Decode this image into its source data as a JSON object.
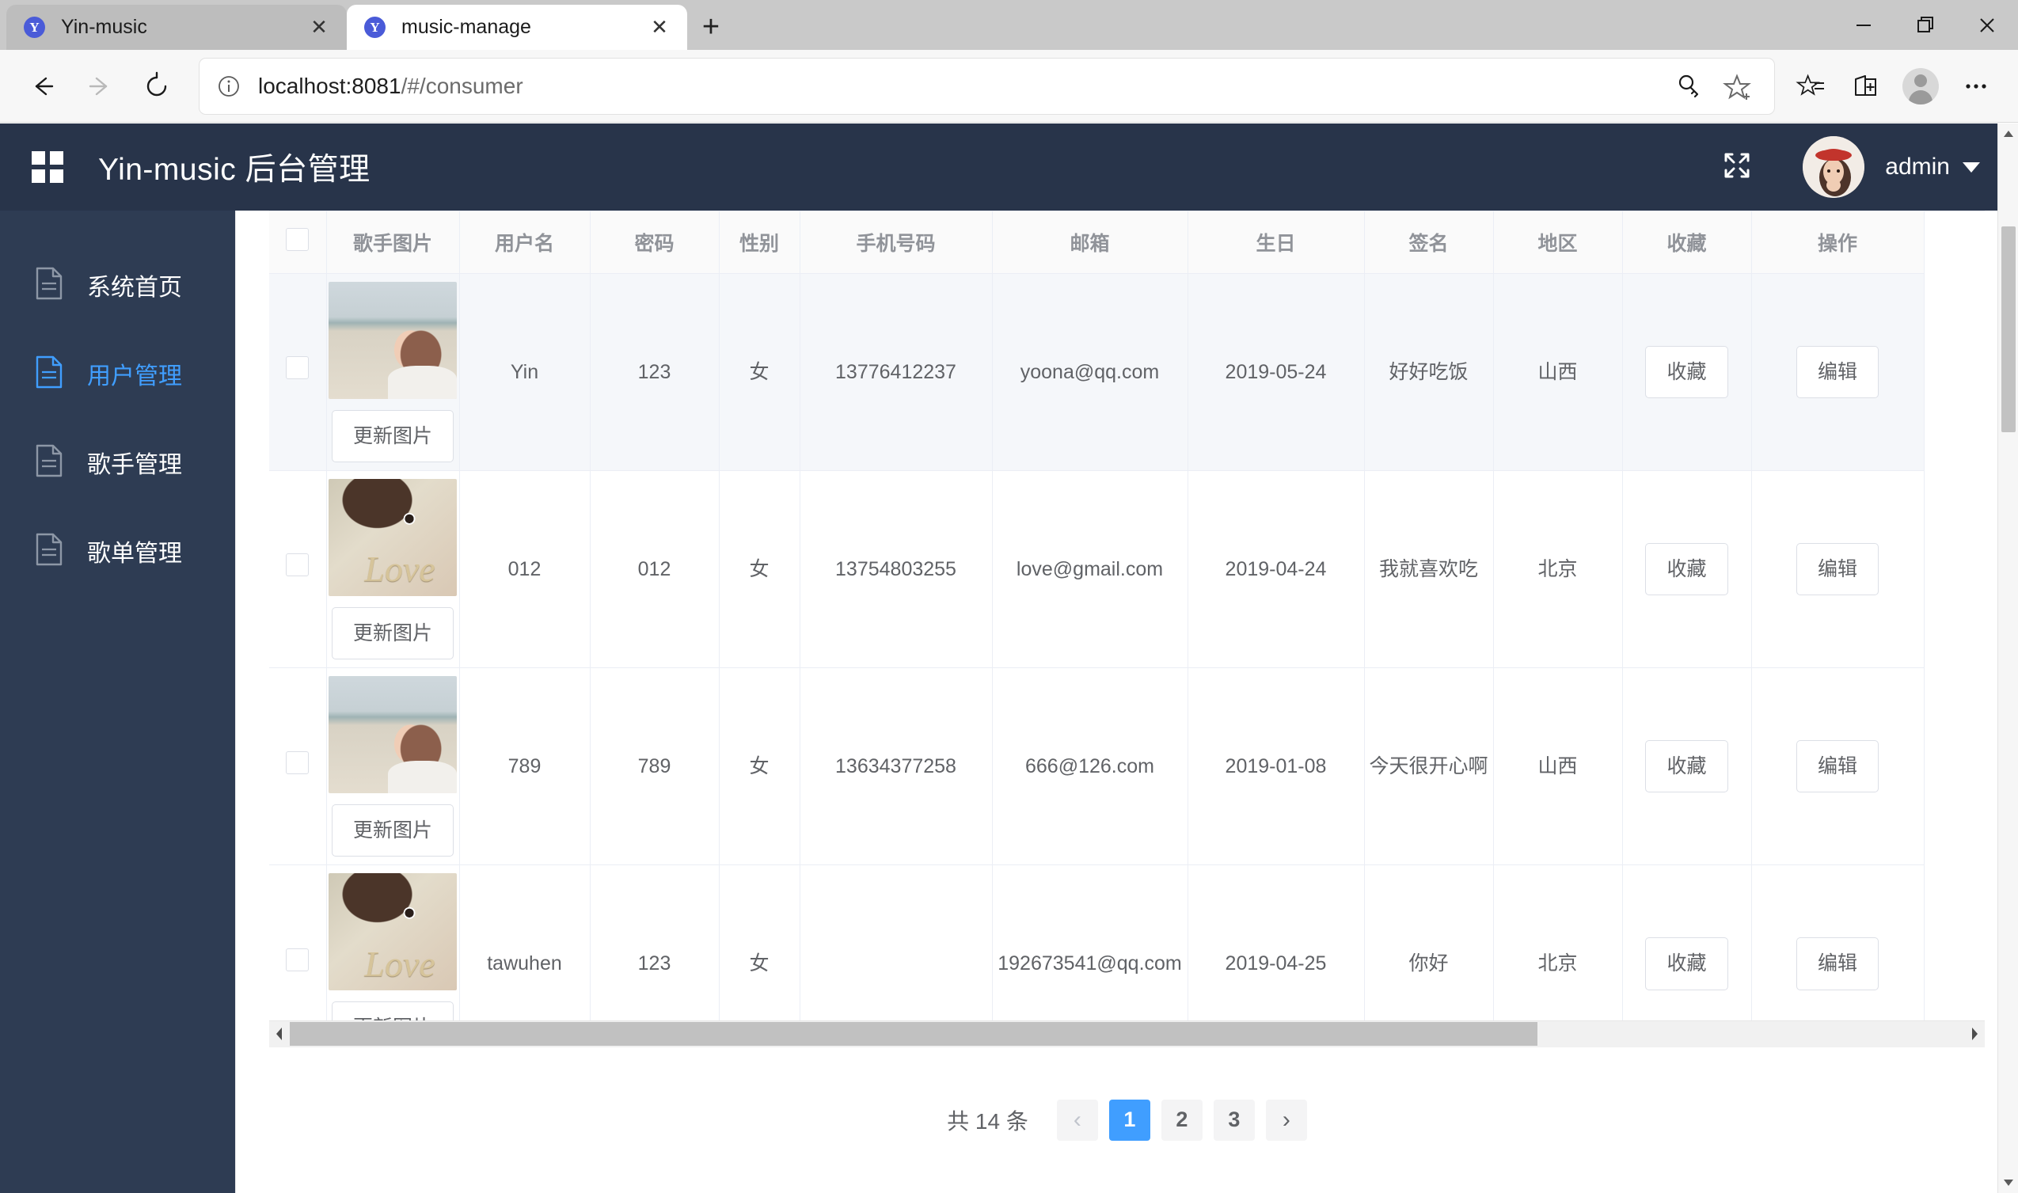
{
  "browser": {
    "tabs": [
      {
        "title": "Yin-music",
        "favicon": "Y",
        "active": false
      },
      {
        "title": "music-manage",
        "favicon": "Y",
        "active": true
      }
    ],
    "new_tab_label": "+",
    "close_label": "✕",
    "window_controls": {
      "minimize": "—",
      "maximize": "❐",
      "close": "✕"
    },
    "url": "localhost:8081",
    "url_path": "/#/consumer",
    "nav": {
      "back": "back-arrow",
      "forward": "forward-arrow",
      "reload": "reload-arrow"
    },
    "toolbar_icons": [
      "key-icon",
      "favorite-star-icon",
      "collections-icon",
      "browser-essentials-icon",
      "profile-icon",
      "settings-more-icon"
    ]
  },
  "app": {
    "logo_icon": "grid-apps-icon",
    "title": "Yin-music 后台管理",
    "expand_icon": "fullscreen-expand-icon",
    "user": "admin",
    "user_caret": "chevron-down-icon"
  },
  "sidebar": {
    "items": [
      {
        "label": "系统首页",
        "icon": "document-icon",
        "active": false
      },
      {
        "label": "用户管理",
        "icon": "document-icon",
        "active": true
      },
      {
        "label": "歌手管理",
        "icon": "document-icon",
        "active": false
      },
      {
        "label": "歌单管理",
        "icon": "document-icon",
        "active": false
      }
    ]
  },
  "table": {
    "columns": [
      {
        "key": "check",
        "label": ""
      },
      {
        "key": "img",
        "label": "歌手图片"
      },
      {
        "key": "username",
        "label": "用户名"
      },
      {
        "key": "password",
        "label": "密码"
      },
      {
        "key": "sex",
        "label": "性别"
      },
      {
        "key": "phone",
        "label": "手机号码"
      },
      {
        "key": "email",
        "label": "邮箱"
      },
      {
        "key": "birth",
        "label": "生日"
      },
      {
        "key": "sign",
        "label": "签名"
      },
      {
        "key": "area",
        "label": "地区"
      },
      {
        "key": "fav",
        "label": "收藏"
      },
      {
        "key": "op",
        "label": "操作"
      }
    ],
    "update_image_label": "更新图片",
    "fav_label": "收藏",
    "edit_label": "编辑",
    "rows": [
      {
        "img_kind": "beach",
        "username": "Yin",
        "password": "123",
        "sex": "女",
        "phone": "13776412237",
        "email": "yoona@qq.com",
        "birth": "2019-05-24",
        "sign": "好好吃饭",
        "area": "山西"
      },
      {
        "img_kind": "love",
        "username": "012",
        "password": "012",
        "sex": "女",
        "phone": "13754803255",
        "email": "love@gmail.com",
        "birth": "2019-04-24",
        "sign": "我就喜欢吃",
        "area": "北京"
      },
      {
        "img_kind": "beach",
        "username": "789",
        "password": "789",
        "sex": "女",
        "phone": "13634377258",
        "email": "666@126.com",
        "birth": "2019-01-08",
        "sign": "今天很开心啊",
        "area": "山西"
      },
      {
        "img_kind": "love",
        "username": "tawuhen",
        "password": "123",
        "sex": "女",
        "phone": "",
        "email": "192673541@qq.com",
        "birth": "2019-04-25",
        "sign": "你好",
        "area": "北京"
      }
    ]
  },
  "pagination": {
    "total_text": "共 14 条",
    "prev": "‹",
    "next": "›",
    "pages": [
      "1",
      "2",
      "3"
    ],
    "current": "1"
  },
  "colors": {
    "header_bg": "#28344a",
    "sidebar_bg": "#2e3c53",
    "accent": "#409eff",
    "text": "#606266"
  }
}
